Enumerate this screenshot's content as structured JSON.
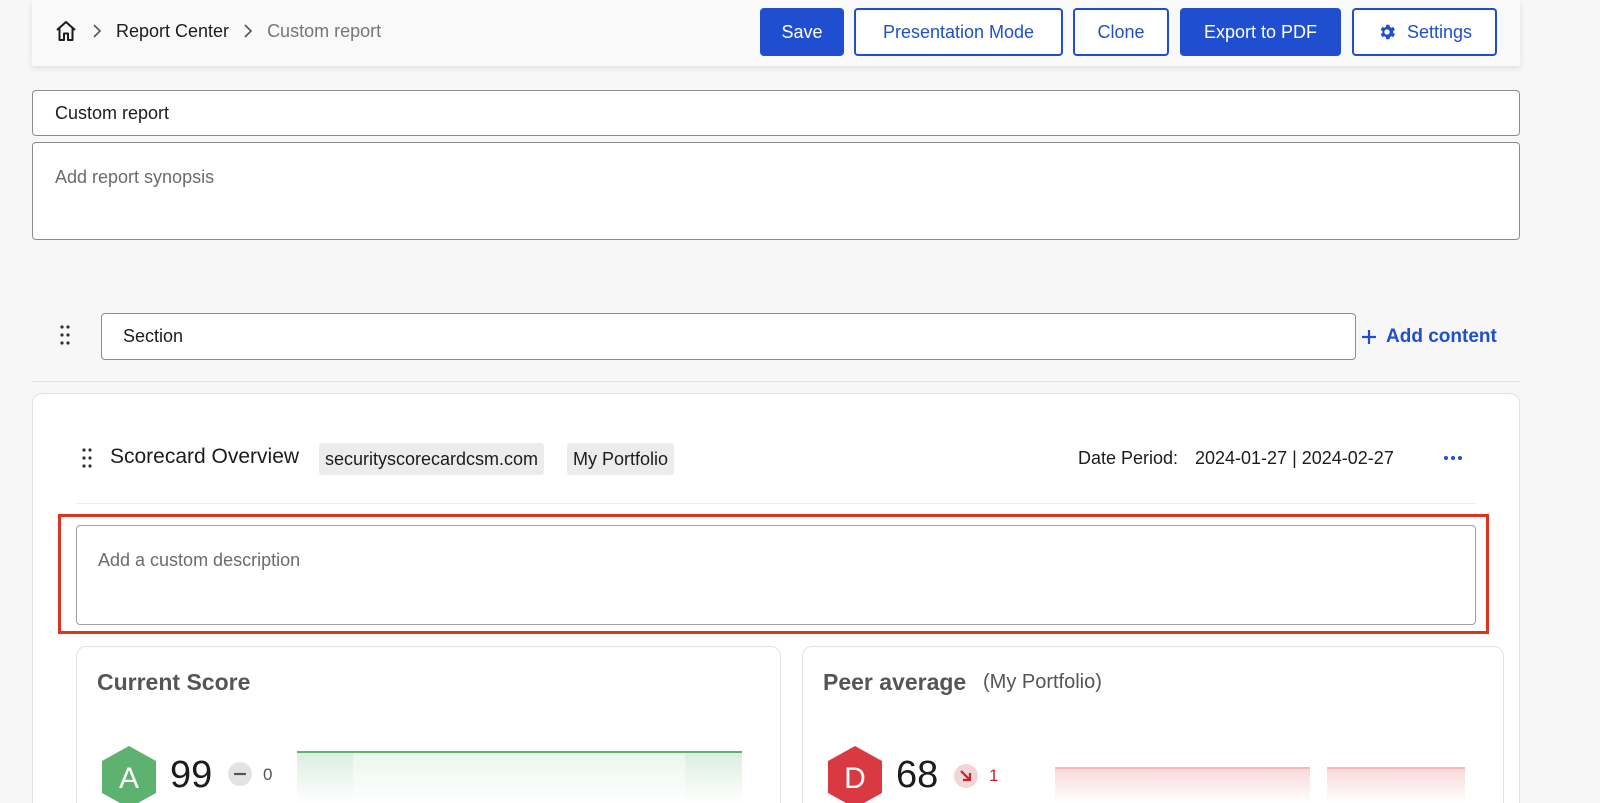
{
  "breadcrumb": {
    "items": [
      "Report Center"
    ],
    "current": "Custom report"
  },
  "toolbar": {
    "save_label": "Save",
    "presentation_label": "Presentation Mode",
    "clone_label": "Clone",
    "export_label": "Export to PDF",
    "settings_label": "Settings"
  },
  "report": {
    "title_value": "Custom report",
    "synopsis_placeholder": "Add report synopsis"
  },
  "section": {
    "name_value": "Section",
    "add_content_label": "Add content"
  },
  "widget": {
    "title": "Scorecard Overview",
    "tags": [
      "securityscorecardcsm.com",
      "My Portfolio"
    ],
    "date_label": "Date Period:",
    "date_value": "2024-01-27 | 2024-02-27",
    "description_placeholder": "Add a custom description"
  },
  "current_score": {
    "title": "Current Score",
    "grade": "A",
    "score": "99",
    "change": "0",
    "trend": "flat",
    "grade_color": "#5cb26e"
  },
  "peer_average": {
    "title": "Peer average",
    "subtitle": "(My Portfolio)",
    "grade": "D",
    "score": "68",
    "change": "1",
    "trend": "down",
    "grade_color": "#d93a42"
  },
  "colors": {
    "primary": "#1f4fd0",
    "highlight": "#e0321f",
    "trend_down": "#c0262f"
  },
  "icons": {
    "home": "home-icon",
    "separator": "chevron-right-icon",
    "settings": "gear-icon",
    "add": "plus-icon",
    "drag": "drag-handle-icon",
    "more": "more-horizontal-icon"
  }
}
